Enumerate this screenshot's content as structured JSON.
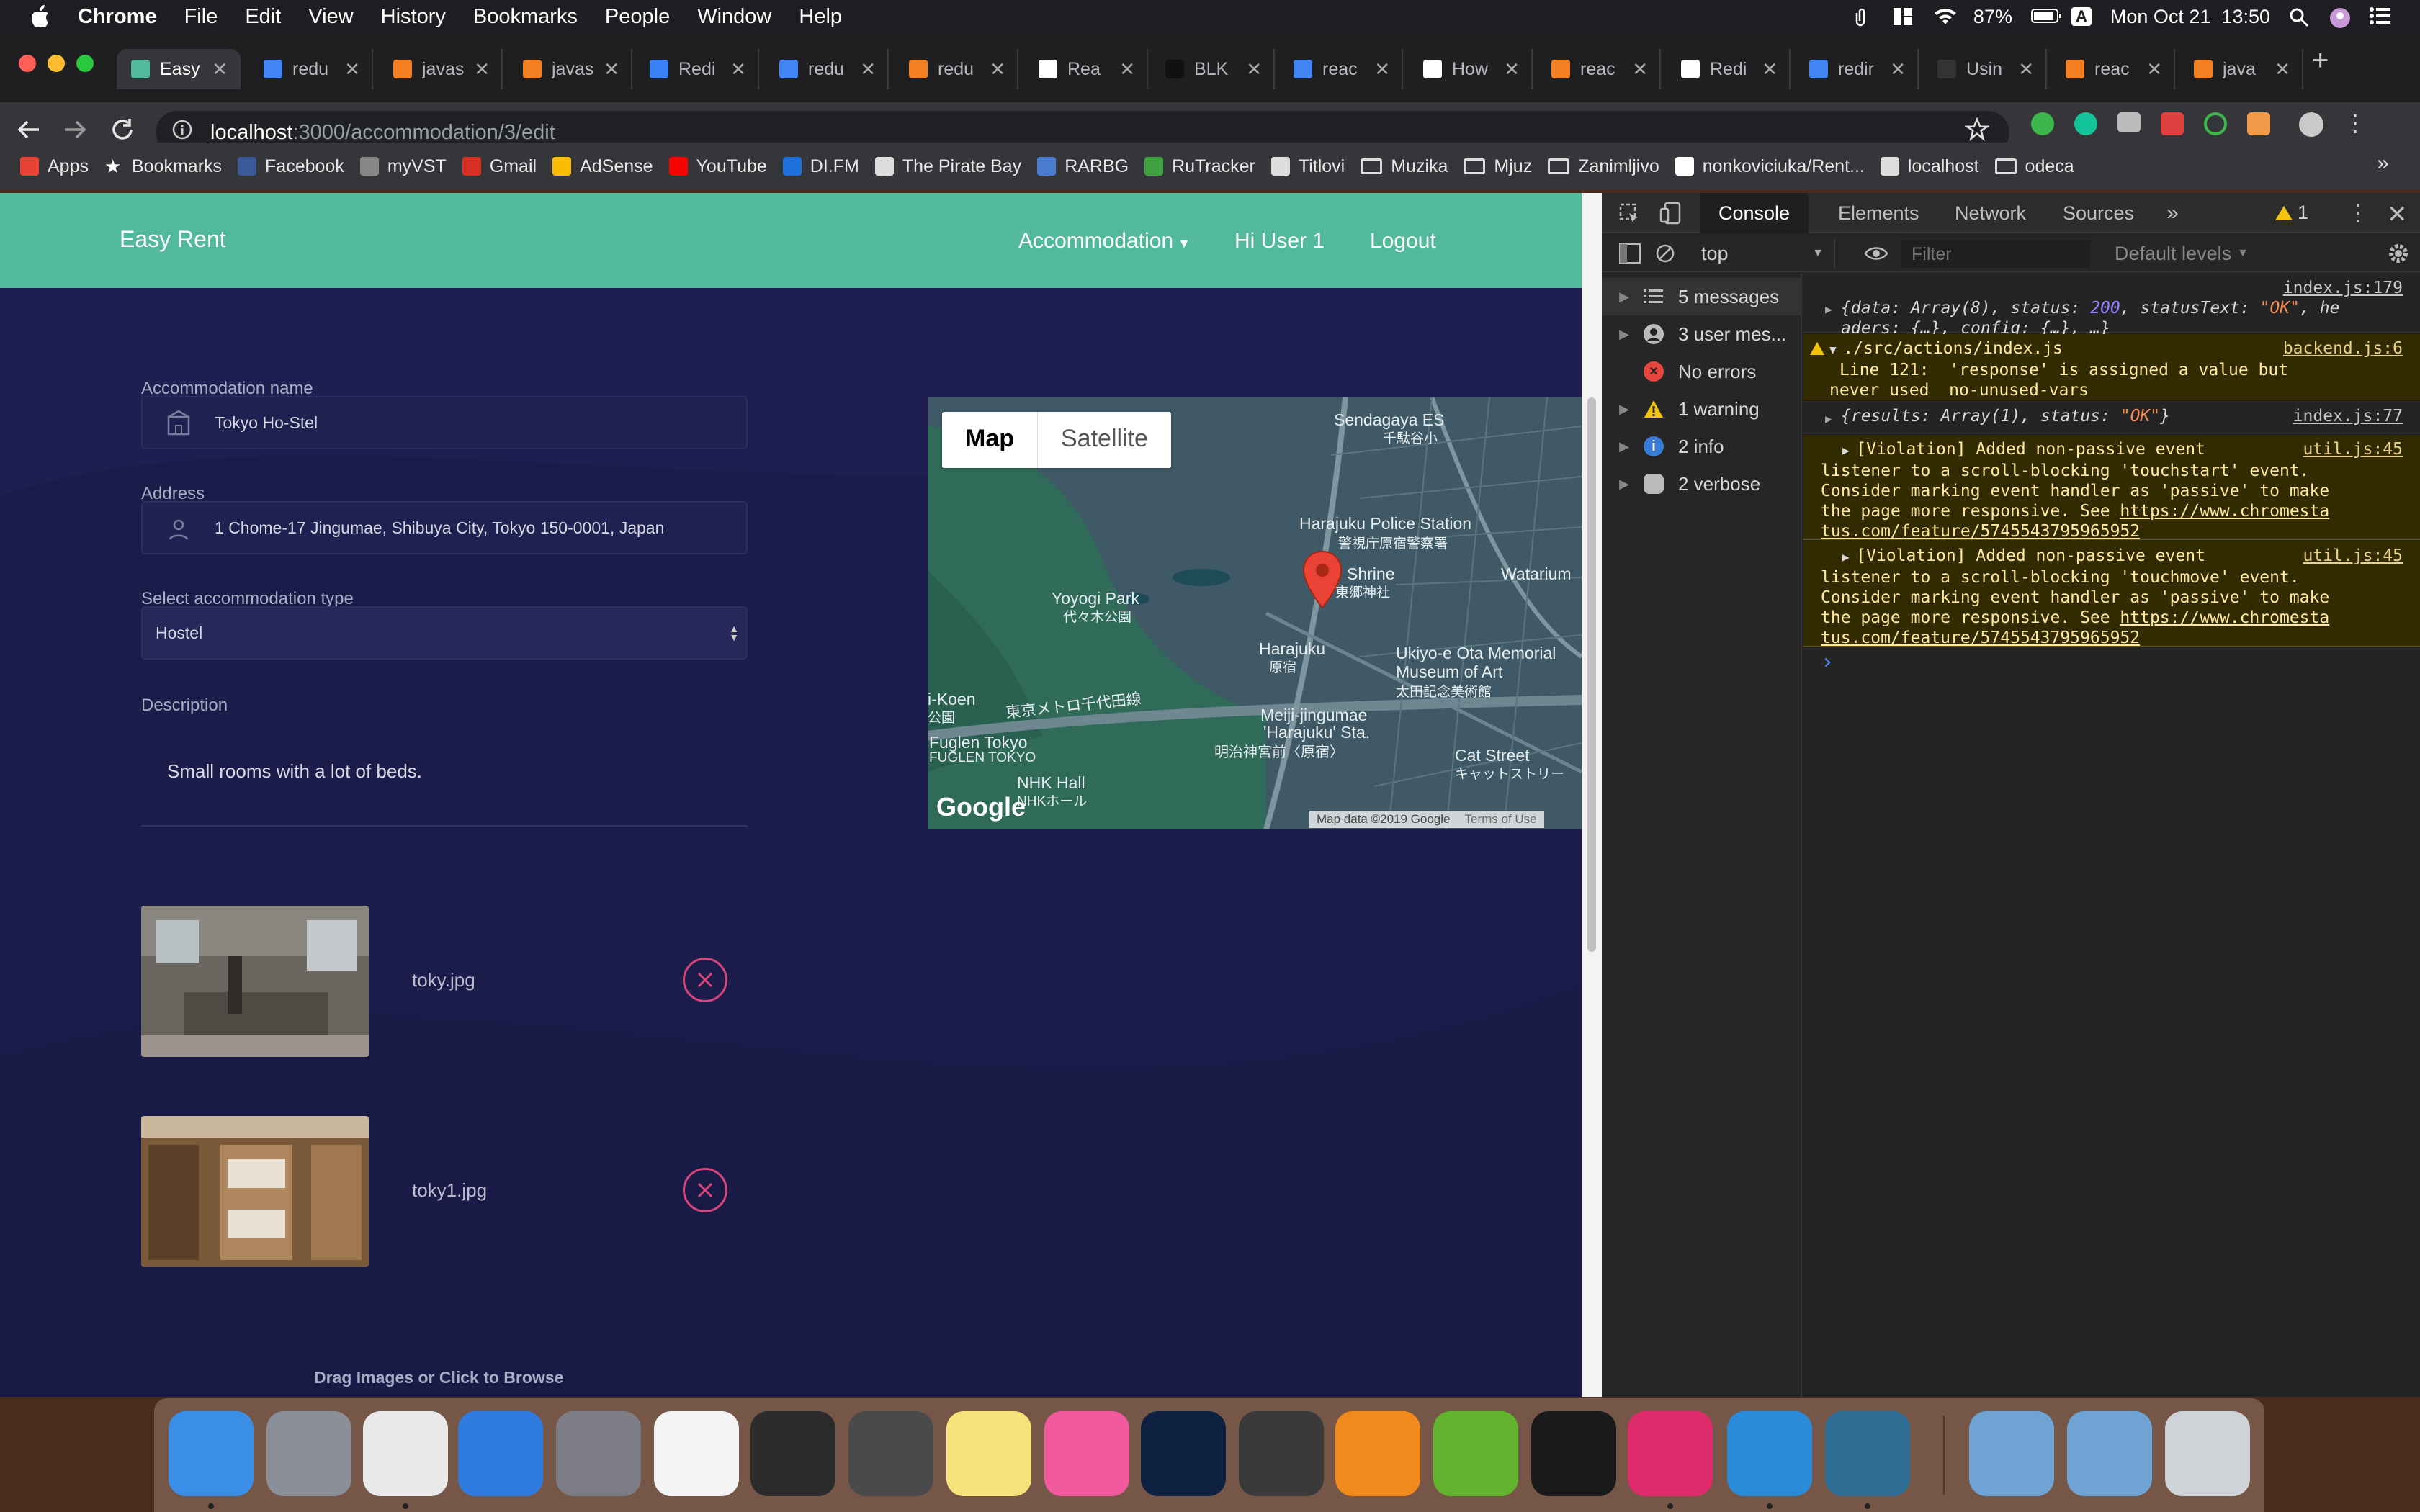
{
  "menubar": {
    "app": "Chrome",
    "items": [
      "File",
      "Edit",
      "View",
      "History",
      "Bookmarks",
      "People",
      "Window",
      "Help"
    ],
    "battery": "87%",
    "input_source": "A",
    "clock": "Mon Oct 21  13:50"
  },
  "tabs": [
    {
      "label": "Easy",
      "color": "#52b99b",
      "active": true
    },
    {
      "label": "redu",
      "color": "#4285f4"
    },
    {
      "label": "javas",
      "color": "#f48024"
    },
    {
      "label": "javas",
      "color": "#f48024"
    },
    {
      "label": "Redi",
      "color": "#3b82f6"
    },
    {
      "label": "redu",
      "color": "#4285f4"
    },
    {
      "label": "redu",
      "color": "#f48024"
    },
    {
      "label": "Rea",
      "color": "#ffffff"
    },
    {
      "label": "BLK",
      "color": "#111111"
    },
    {
      "label": "reac",
      "color": "#4285f4"
    },
    {
      "label": "How",
      "color": "#ffffff"
    },
    {
      "label": "reac",
      "color": "#f48024"
    },
    {
      "label": "Redi",
      "color": "#ffffff"
    },
    {
      "label": "redir",
      "color": "#4285f4"
    },
    {
      "label": "Usin",
      "color": "#333333"
    },
    {
      "label": "reac",
      "color": "#f48024"
    },
    {
      "label": "java",
      "color": "#f48024"
    }
  ],
  "address": {
    "host": "localhost",
    "path": ":3000/accommodation/3/edit"
  },
  "bookmarks": [
    {
      "label": "Apps",
      "icon": "apps-grid-icon",
      "color": "#e94235"
    },
    {
      "label": "Bookmarks",
      "icon": "star-icon",
      "color": "#ffffff"
    },
    {
      "label": "Facebook",
      "icon": "facebook-icon",
      "color": "#3b5998"
    },
    {
      "label": "myVST",
      "icon": "myvst-icon",
      "color": "#888888"
    },
    {
      "label": "Gmail",
      "icon": "gmail-icon",
      "color": "#d93025"
    },
    {
      "label": "AdSense",
      "icon": "adsense-icon",
      "color": "#fbbc04"
    },
    {
      "label": "YouTube",
      "icon": "youtube-icon",
      "color": "#ff0000"
    },
    {
      "label": "DI.FM",
      "icon": "difm-icon",
      "color": "#1e6fd9"
    },
    {
      "label": "The Pirate Bay",
      "icon": "piratebay-icon",
      "color": "#dddddd"
    },
    {
      "label": "RARBG",
      "icon": "rarbg-icon",
      "color": "#4a7bd0"
    },
    {
      "label": "RuTracker",
      "icon": "rutracker-icon",
      "color": "#3ea03e"
    },
    {
      "label": "Titlovi",
      "icon": "titlovi-icon",
      "color": "#dddddd"
    },
    {
      "label": "Muzika",
      "icon": "folder-icon",
      "color": "#dddddd"
    },
    {
      "label": "Mjuz",
      "icon": "folder-icon",
      "color": "#dddddd"
    },
    {
      "label": "Zanimljivo",
      "icon": "folder-icon",
      "color": "#dddddd"
    },
    {
      "label": "nonkoviciuka/Rent...",
      "icon": "github-icon",
      "color": "#ffffff"
    },
    {
      "label": "localhost",
      "icon": "globe-icon",
      "color": "#dddddd"
    },
    {
      "label": "odeca",
      "icon": "folder-icon",
      "color": "#dddddd"
    }
  ],
  "app": {
    "brand": "Easy Rent",
    "nav": {
      "accommodation": "Accommodation",
      "user": "Hi User 1",
      "logout": "Logout"
    },
    "form": {
      "name_label": "Accommodation name",
      "name_value": "Tokyo Ho-Stel",
      "address_label": "Address",
      "address_value": "1 Chome-17 Jingumae, Shibuya City, Tokyo 150-0001, Japan",
      "type_label": "Select accommodation type",
      "type_value": "Hostel",
      "desc_label": "Description",
      "desc_value": "Small rooms with a lot of beds."
    },
    "images": [
      {
        "filename": "toky.jpg"
      },
      {
        "filename": "toky1.jpg"
      }
    ],
    "dropzone": "Drag Images or Click to Browse"
  },
  "map": {
    "btn_map": "Map",
    "btn_satellite": "Satellite",
    "labels": {
      "sendagaya": "Sendagaya ES",
      "sendagaya_jp": "千駄谷小",
      "police": "Harajuku Police Station",
      "police_jp": "警視庁原宿警察署",
      "yoyogi": "Yoyogi Park",
      "yoyogi_jp": "代々木公園",
      "shrine": "Shrine",
      "shrine_jp": "東郷神社",
      "watarium": "Watarium",
      "harajuku": "Harajuku",
      "harajuku_jp": "原宿",
      "ukiyoe": "Ukiyo-e Ota Memorial",
      "ukiyoe2": "Museum of Art",
      "ukiyoe_jp": "太田記念美術館",
      "line": "東京メトロ千代田線",
      "koen": "i-Koen",
      "koen_jp": "公園",
      "meiji": "Meiji-jingumae",
      "meiji2": "'Harajuku' Sta.",
      "meiji_jp": "明治神宮前〈原宿〉",
      "fuglen": "Fuglen Tokyo",
      "fuglen2": "FUGLEN TOKYO",
      "catstreet": "Cat Street",
      "catstreet_jp": "キャットストリー",
      "nhk": "NHK Hall",
      "nhk_jp": "NHKホール",
      "google": "Google",
      "mapdata": "Map data ©2019 Google",
      "terms": "Terms of Use"
    }
  },
  "devtools": {
    "tabs": [
      "Console",
      "Elements",
      "Network",
      "Sources"
    ],
    "more": "»",
    "warning_badge": "1",
    "context": "top",
    "filter_placeholder": "Filter",
    "levels": "Default levels",
    "sidebar": [
      {
        "label": "5 messages",
        "icon": "list-icon",
        "color": "#bbbbbb"
      },
      {
        "label": "3 user mes...",
        "icon": "user-icon",
        "color": "#bbbbbb"
      },
      {
        "label": "No errors",
        "icon": "error-icon",
        "color": "#e8453c"
      },
      {
        "label": "1 warning",
        "icon": "warning-icon",
        "color": "#f2c40f"
      },
      {
        "label": "2 info",
        "icon": "info-icon",
        "color": "#3a7bd5"
      },
      {
        "label": "2 verbose",
        "icon": "bug-icon",
        "color": "#bbbbbb"
      }
    ],
    "console": [
      {
        "src": "index.js:179",
        "parts": [
          "{data: Array(8), status: ",
          "200",
          ", statusText: ",
          "\"OK\"",
          ", he",
          "aders: {…}, config: {…}, …}"
        ]
      },
      {
        "src": "backend.js:6",
        "text1": "./src/actions/index.js",
        "text2": "Line 121:  'response' is assigned a value but",
        "text3": "never used  no-unused-vars"
      },
      {
        "src": "index.js:77",
        "parts": [
          "{results: Array(1), status: ",
          "\"OK\"",
          "}"
        ]
      },
      {
        "src": "util.js:45",
        "l1": "[Violation] Added non-passive event",
        "l2": "listener to a scroll-blocking 'touchstart' event.",
        "l3": "Consider marking event handler as 'passive' to make",
        "l4": "the page more responsive. See ",
        "link1": "https://www.chromesta",
        "link2": "tus.com/feature/5745543795965952"
      },
      {
        "src": "util.js:45",
        "l1": "[Violation] Added non-passive event",
        "l2": "listener to a scroll-blocking 'touchmove' event.",
        "l3": "Consider marking event handler as 'passive' to make",
        "l4": "the page more responsive. See ",
        "link1": "https://www.chromesta",
        "link2": "tus.com/feature/5745543795965952"
      }
    ],
    "prompt": "›"
  },
  "dock": [
    {
      "name": "finder",
      "color": "#3a8ee6",
      "running": true
    },
    {
      "name": "launchpad",
      "color": "#8a8f99"
    },
    {
      "name": "chrome",
      "color": "#e9e9e9",
      "running": true
    },
    {
      "name": "safari",
      "color": "#2f7be0"
    },
    {
      "name": "system-preferences",
      "color": "#7d7d85"
    },
    {
      "name": "photos",
      "color": "#f4f4f4"
    },
    {
      "name": "final-cut",
      "color": "#2b2b2b"
    },
    {
      "name": "unknown-app",
      "color": "#4a4a4a"
    },
    {
      "name": "notes",
      "color": "#f8e27a"
    },
    {
      "name": "itunes",
      "color": "#f25aa0"
    },
    {
      "name": "photoshop",
      "color": "#0f2140"
    },
    {
      "name": "ableton-live",
      "color": "#3a3a3a"
    },
    {
      "name": "vlc",
      "color": "#f08a1c"
    },
    {
      "name": "utorrent",
      "color": "#62b32e"
    },
    {
      "name": "terminal",
      "color": "#1a1a1a"
    },
    {
      "name": "intellij",
      "color": "#dd2b6c",
      "running": true
    },
    {
      "name": "vscode",
      "color": "#2a8bd8",
      "running": true
    },
    {
      "name": "mysql-workbench",
      "color": "#2d6d94",
      "running": true
    },
    {
      "name": "applications-folder",
      "color": "#6fa3d4"
    },
    {
      "name": "downloads-folder",
      "color": "#6fa3d4"
    },
    {
      "name": "trash",
      "color": "#cfd2d6"
    }
  ]
}
